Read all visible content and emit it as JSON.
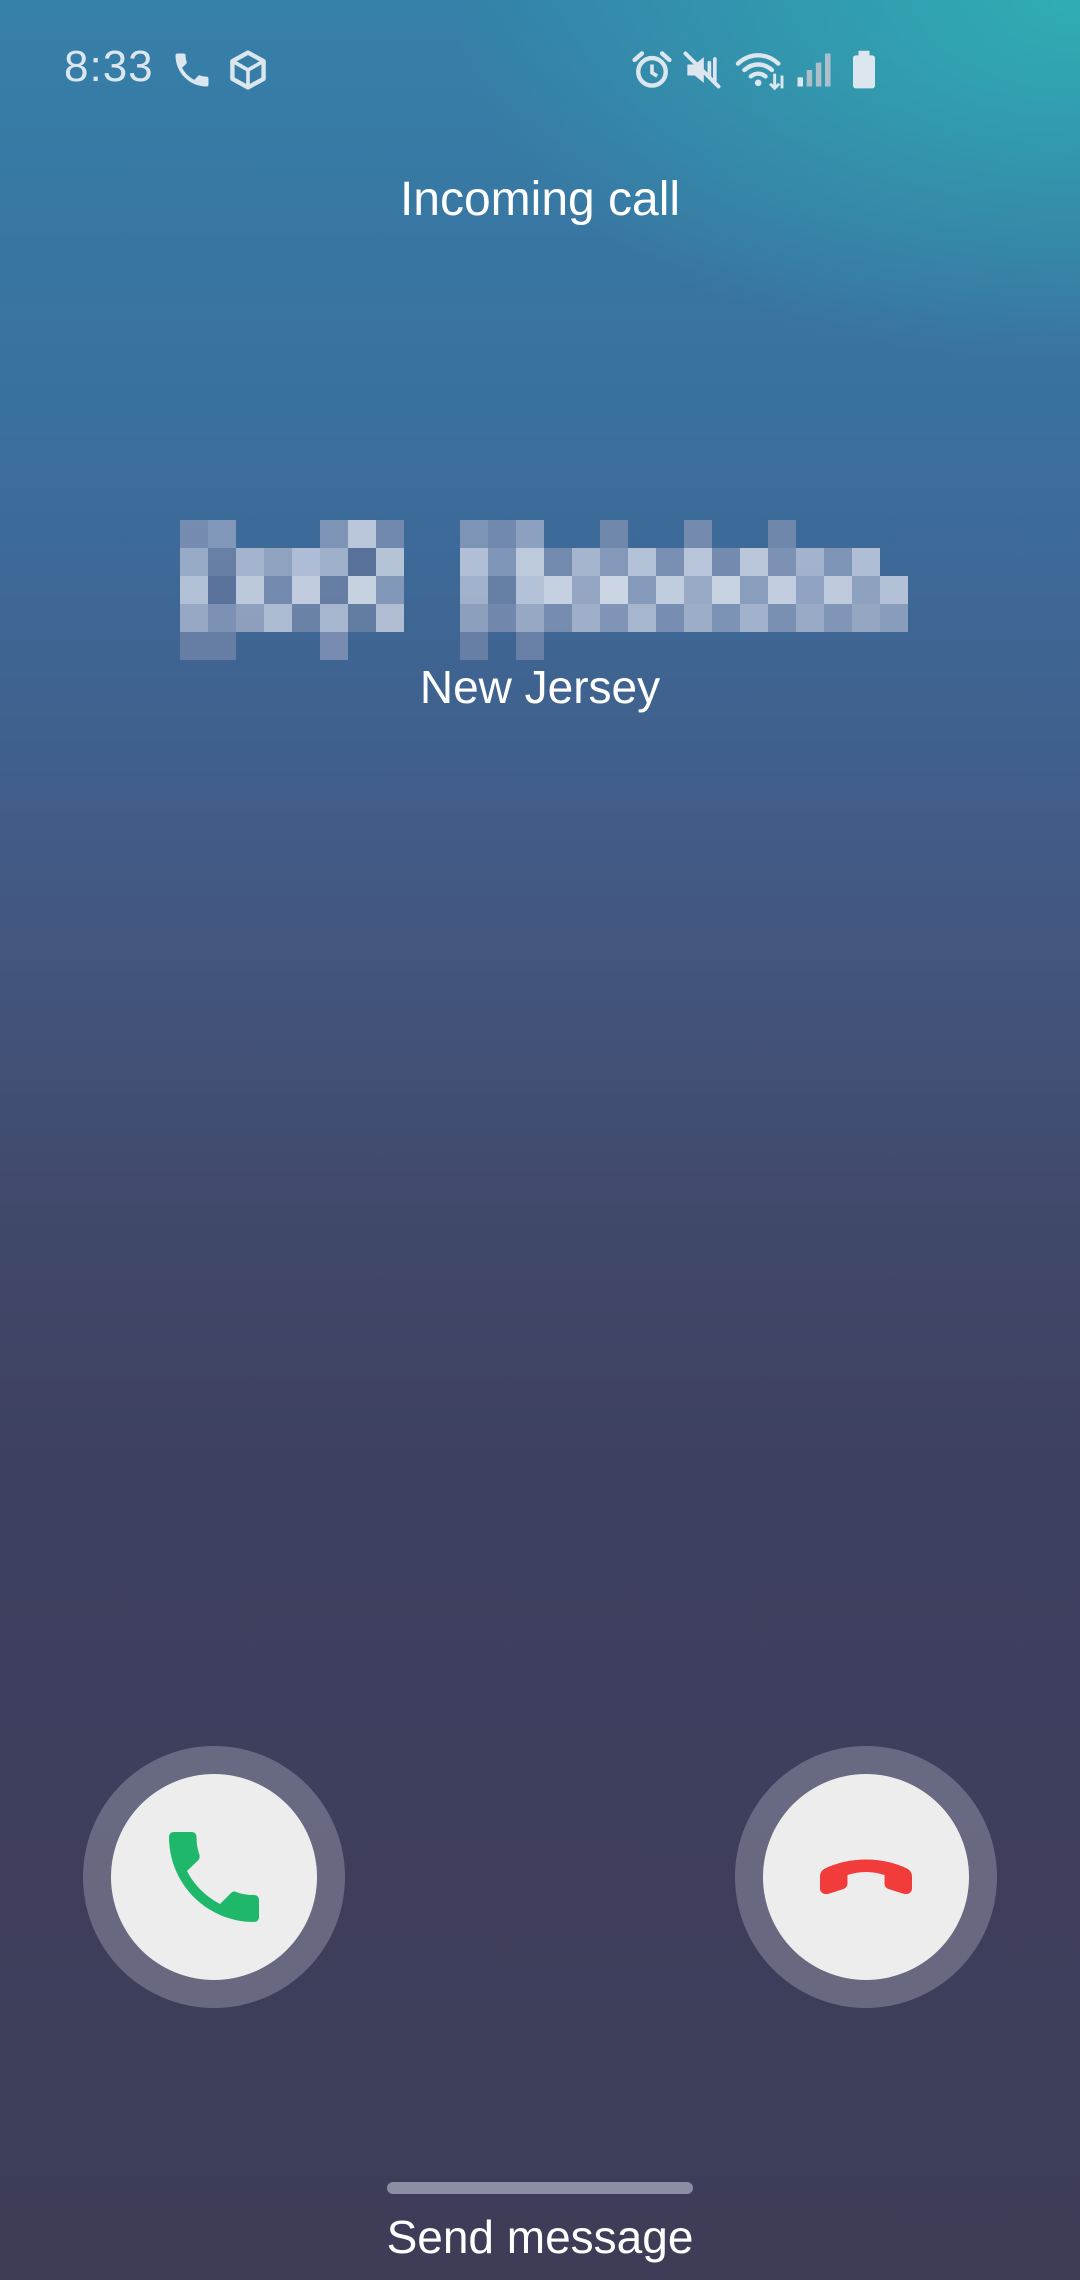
{
  "status_bar": {
    "time": "8:33",
    "left_icons": [
      "phone-call-icon",
      "cube-app-icon"
    ],
    "right_icons": [
      "alarm-icon",
      "vibrate-mute-icon",
      "wifi-icon",
      "signal-icon",
      "battery-icon"
    ]
  },
  "call": {
    "label": "Incoming call",
    "caller_name_icon": "pixelated-redaction",
    "location": "New Jersey"
  },
  "actions": {
    "accept_icon": "phone-answer-icon",
    "decline_icon": "phone-hangup-icon",
    "accept_color": "#1fb86a",
    "decline_color": "#f23b3b",
    "send_message_label": "Send message"
  }
}
